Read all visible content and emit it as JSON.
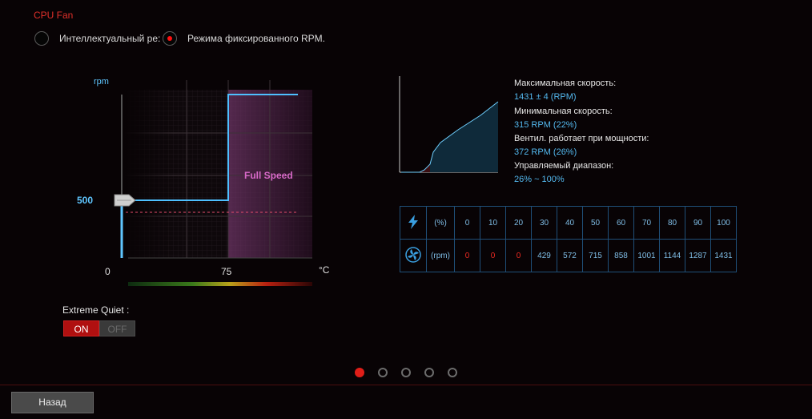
{
  "title": "CPU Fan",
  "modes": {
    "smart_label": "Интеллектуальный ре:",
    "fixed_label": "Режима фиксированного RPM.",
    "selected": "fixed"
  },
  "graph": {
    "y_unit": "rpm",
    "y_value_label": "500",
    "x_tick_0": "0",
    "x_tick_75": "75",
    "x_unit": "°C",
    "zone_label": "Full Speed"
  },
  "extreme_quiet": {
    "label": "Extreme Quiet :",
    "on_label": "ON",
    "off_label": "OFF",
    "state": "on"
  },
  "info": {
    "max_speed_label": "Максимальная скорость:",
    "max_speed_value": "1431 ± 4 (RPM)",
    "min_speed_label": "Минимальная скорость:",
    "min_speed_value": "315 RPM (22%)",
    "start_label": "Вентил. работает при мощности:",
    "start_value": "372 RPM (26%)",
    "range_label": "Управляемый диапазон:",
    "range_value": "26% ~ 100%"
  },
  "table": {
    "power_label": "(%)",
    "rpm_label": "(rpm)",
    "percent": [
      "0",
      "10",
      "20",
      "30",
      "40",
      "50",
      "60",
      "70",
      "80",
      "90",
      "100"
    ],
    "rpm": [
      "0",
      "0",
      "0",
      "429",
      "572",
      "715",
      "858",
      "1001",
      "1144",
      "1287",
      "1431"
    ],
    "icons": {
      "power": "lightning-icon",
      "fan": "fan-icon"
    }
  },
  "pagination": {
    "pages": 5,
    "active": 0
  },
  "footer": {
    "back_label": "Назад"
  },
  "colors": {
    "accent_red": "#e0302a",
    "accent_blue": "#5fc6ff",
    "zone_purple": "#d869c8"
  }
}
